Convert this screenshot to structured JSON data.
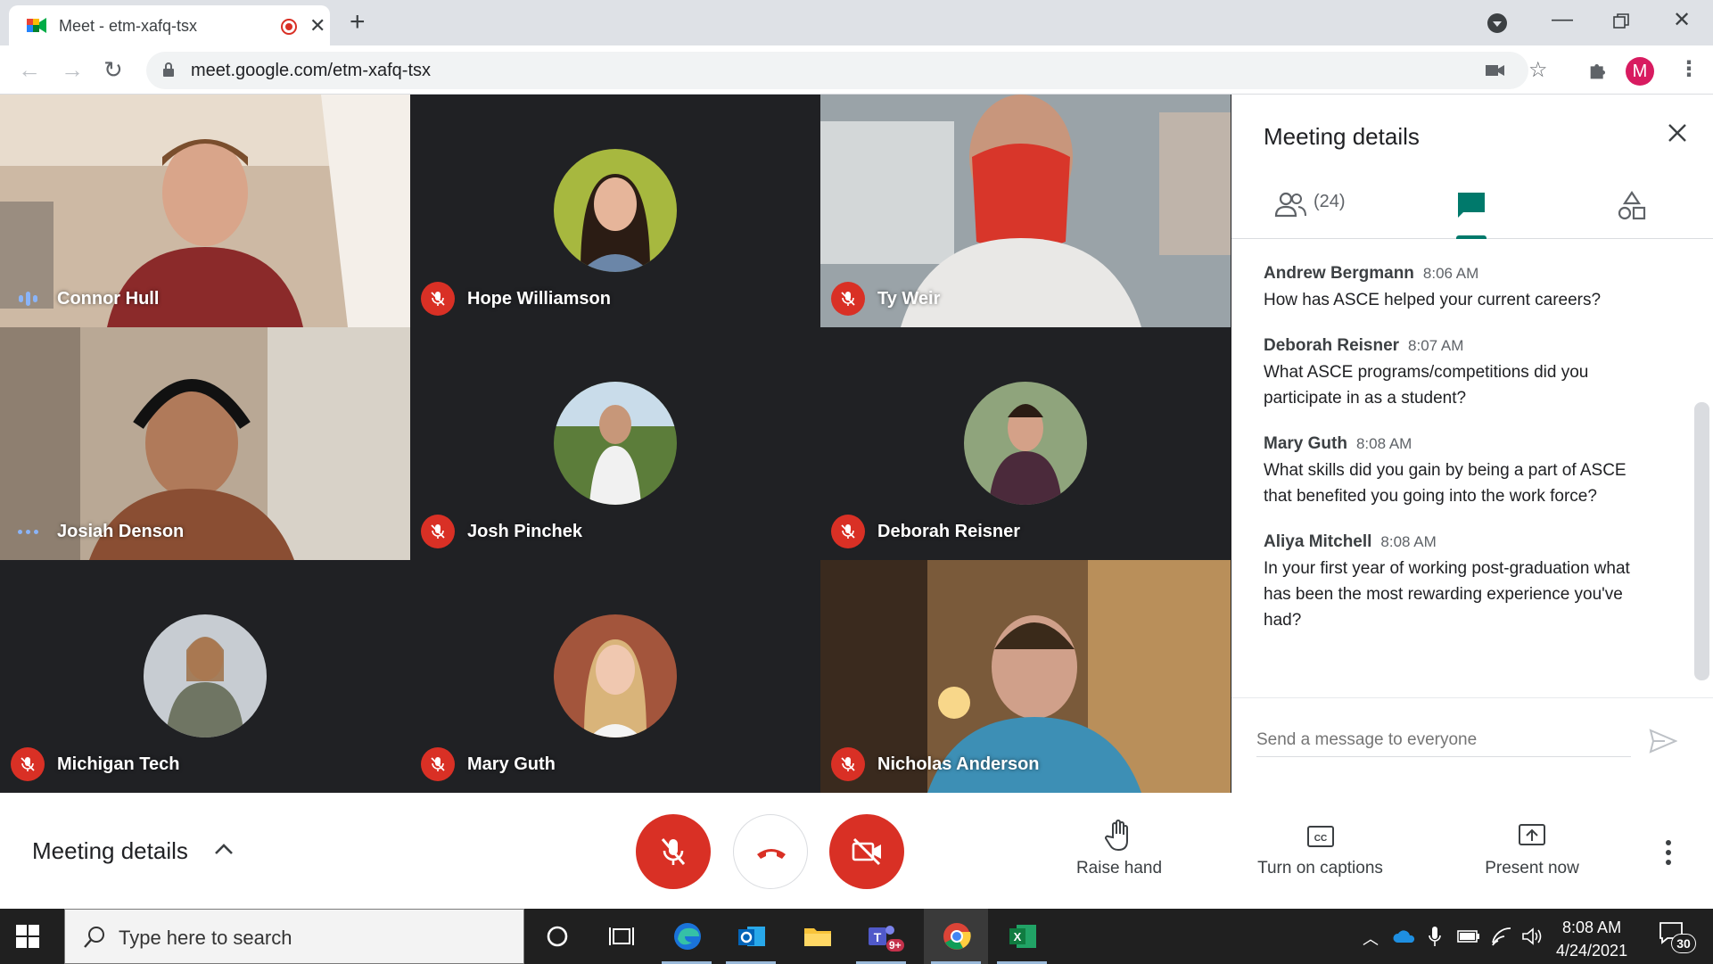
{
  "browser": {
    "tab_title": "Meet - etm-xafq-tsx",
    "url": "meet.google.com/etm-xafq-tsx",
    "profile_initial": "M"
  },
  "participants": [
    {
      "name": "Connor Hull",
      "state": "speaking"
    },
    {
      "name": "Hope Williamson",
      "state": "muted"
    },
    {
      "name": "Ty Weir",
      "state": "muted"
    },
    {
      "name": "Josiah Denson",
      "state": "active"
    },
    {
      "name": "Josh Pinchek",
      "state": "muted"
    },
    {
      "name": "Deborah Reisner",
      "state": "muted"
    },
    {
      "name": "Michigan Tech",
      "state": "muted"
    },
    {
      "name": "Mary Guth",
      "state": "muted"
    },
    {
      "name": "Nicholas Anderson",
      "state": "muted"
    }
  ],
  "panel": {
    "title": "Meeting details",
    "people_count": "(24)",
    "messages": [
      {
        "sender": "Andrew Bergmann",
        "time": "8:06 AM",
        "text": "How has ASCE helped your current careers?"
      },
      {
        "sender": "Deborah Reisner",
        "time": "8:07 AM",
        "text": "What ASCE programs/competitions did you participate in as a student?"
      },
      {
        "sender": "Mary Guth",
        "time": "8:08 AM",
        "text": "What skills did you gain by being a part of ASCE that benefited you going into the work force?"
      },
      {
        "sender": "Aliya Mitchell",
        "time": "8:08 AM",
        "text": "In your first year of working post-graduation what has been the most rewarding experience you've had?"
      }
    ],
    "composer_placeholder": "Send a message to everyone"
  },
  "controls": {
    "meeting_details_label": "Meeting details",
    "raise_hand": "Raise hand",
    "captions": "Turn on captions",
    "present": "Present now"
  },
  "taskbar": {
    "search_placeholder": "Type here to search",
    "time": "8:08 AM",
    "date": "4/24/2021",
    "notifications": "30",
    "teams_badge": "9+"
  },
  "colors": {
    "accent_teal": "#00796b",
    "mute_red": "#d93025",
    "tile_dark": "#202124"
  }
}
